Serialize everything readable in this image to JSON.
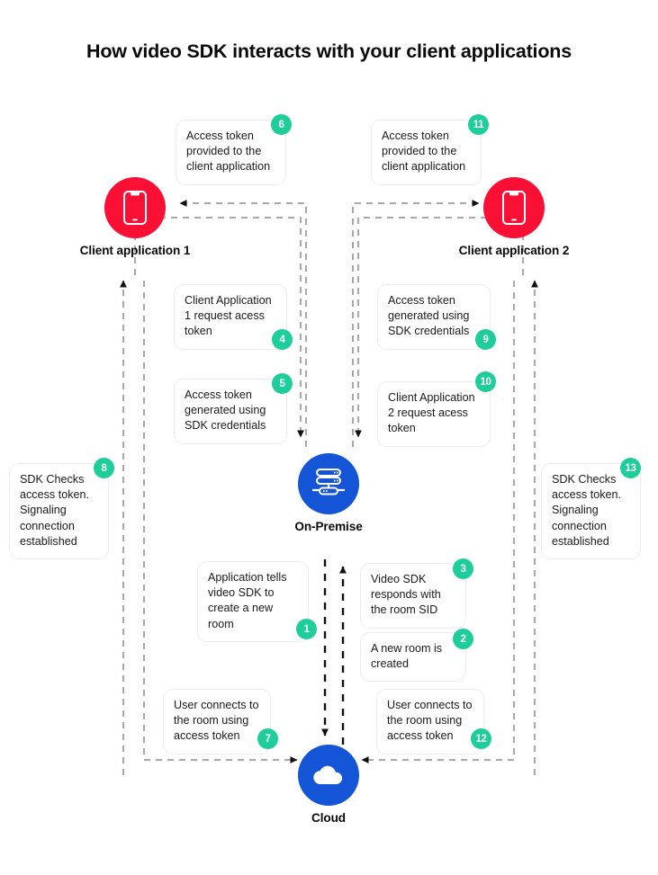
{
  "title": "How video SDK interacts with your client applications",
  "colors": {
    "badge": "#1ece9a",
    "client_node": "#fa0f35",
    "server_node": "#1455d8",
    "cloud_node": "#1455d8",
    "connector": "#a8a8ad",
    "box_border": "#ececf0",
    "text": "#1a1a1a"
  },
  "nodes": [
    {
      "id": "client1",
      "label": "Client application 1",
      "icon": "mobile-phone-icon",
      "color": "#fa0f35"
    },
    {
      "id": "client2",
      "label": "Client application 2",
      "icon": "mobile-phone-icon",
      "color": "#fa0f35"
    },
    {
      "id": "on_premise",
      "label": "On-Premise",
      "icon": "server-rack-icon",
      "color": "#1455d8"
    },
    {
      "id": "cloud",
      "label": "Cloud",
      "icon": "cloud-icon",
      "color": "#1455d8"
    }
  ],
  "steps": [
    {
      "num": "1",
      "text": "Application tells video SDK to create a new room"
    },
    {
      "num": "2",
      "text": "A new room is created"
    },
    {
      "num": "3",
      "text": "Video SDK responds with the room SID"
    },
    {
      "num": "4",
      "text": "Client Application 1 request acess token"
    },
    {
      "num": "5",
      "text": "Access token generated using SDK credentials"
    },
    {
      "num": "6",
      "text": "Access token provided to the client application"
    },
    {
      "num": "7",
      "text": "User connects to the room using access token"
    },
    {
      "num": "8",
      "text": "SDK Checks access token. Signaling connection established"
    },
    {
      "num": "9",
      "text": "Access token generated using SDK credentials"
    },
    {
      "num": "10",
      "text": "Client Application 2 request acess token"
    },
    {
      "num": "11",
      "text": "Access token provided to the client application"
    },
    {
      "num": "12",
      "text": "User connects to the room using access token"
    },
    {
      "num": "13",
      "text": "SDK Checks access token. Signaling connection established"
    }
  ]
}
